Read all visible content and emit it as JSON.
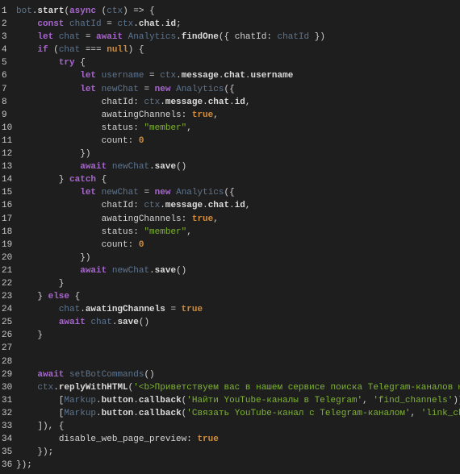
{
  "editor": {
    "colors": {
      "background": "#1e1e1e",
      "keyword": "#a866cf",
      "variable": "#5d7590",
      "property": "#d4d4d4",
      "string": "#7fb432",
      "literal": "#d08c3c"
    },
    "lines": [
      {
        "n": "1",
        "t": [
          [
            "v",
            "bot"
          ],
          [
            "p",
            "."
          ],
          [
            "f",
            "start"
          ],
          [
            "p",
            "("
          ],
          [
            "k",
            "async"
          ],
          [
            "p",
            " ("
          ],
          [
            "v",
            "ctx"
          ],
          [
            "p",
            ") => {"
          ]
        ]
      },
      {
        "n": "2",
        "t": [
          [
            "p",
            "    "
          ],
          [
            "k",
            "const"
          ],
          [
            "p",
            " "
          ],
          [
            "v",
            "chatId"
          ],
          [
            "p",
            " = "
          ],
          [
            "v",
            "ctx"
          ],
          [
            "p",
            "."
          ],
          [
            "f",
            "chat"
          ],
          [
            "p",
            "."
          ],
          [
            "f",
            "id"
          ],
          [
            "p",
            ";"
          ]
        ]
      },
      {
        "n": "3",
        "t": [
          [
            "p",
            "    "
          ],
          [
            "k",
            "let"
          ],
          [
            "p",
            " "
          ],
          [
            "v",
            "chat"
          ],
          [
            "p",
            " = "
          ],
          [
            "k",
            "await"
          ],
          [
            "p",
            " "
          ],
          [
            "v",
            "Analytics"
          ],
          [
            "p",
            "."
          ],
          [
            "f",
            "findOne"
          ],
          [
            "p",
            "({ "
          ],
          [
            "pr",
            "chatId"
          ],
          [
            "p",
            ": "
          ],
          [
            "v",
            "chatId"
          ],
          [
            "p",
            " })"
          ]
        ]
      },
      {
        "n": "4",
        "t": [
          [
            "p",
            "    "
          ],
          [
            "k",
            "if"
          ],
          [
            "p",
            " ("
          ],
          [
            "v",
            "chat"
          ],
          [
            "p",
            " === "
          ],
          [
            "l",
            "null"
          ],
          [
            "p",
            ") {"
          ]
        ]
      },
      {
        "n": "5",
        "t": [
          [
            "p",
            "        "
          ],
          [
            "k",
            "try"
          ],
          [
            "p",
            " {"
          ]
        ]
      },
      {
        "n": "6",
        "t": [
          [
            "p",
            "            "
          ],
          [
            "k",
            "let"
          ],
          [
            "p",
            " "
          ],
          [
            "v",
            "username"
          ],
          [
            "p",
            " = "
          ],
          [
            "v",
            "ctx"
          ],
          [
            "p",
            "."
          ],
          [
            "f",
            "message"
          ],
          [
            "p",
            "."
          ],
          [
            "f",
            "chat"
          ],
          [
            "p",
            "."
          ],
          [
            "f",
            "username"
          ]
        ]
      },
      {
        "n": "7",
        "t": [
          [
            "p",
            "            "
          ],
          [
            "k",
            "let"
          ],
          [
            "p",
            " "
          ],
          [
            "v",
            "newChat"
          ],
          [
            "p",
            " = "
          ],
          [
            "k",
            "new"
          ],
          [
            "p",
            " "
          ],
          [
            "v",
            "Analytics"
          ],
          [
            "p",
            "({"
          ]
        ]
      },
      {
        "n": "8",
        "t": [
          [
            "p",
            "                "
          ],
          [
            "pr",
            "chatId"
          ],
          [
            "p",
            ": "
          ],
          [
            "v",
            "ctx"
          ],
          [
            "p",
            "."
          ],
          [
            "f",
            "message"
          ],
          [
            "p",
            "."
          ],
          [
            "f",
            "chat"
          ],
          [
            "p",
            "."
          ],
          [
            "f",
            "id"
          ],
          [
            "p",
            ","
          ]
        ]
      },
      {
        "n": "9",
        "t": [
          [
            "p",
            "                "
          ],
          [
            "pr",
            "awatingChannels"
          ],
          [
            "p",
            ": "
          ],
          [
            "l",
            "true"
          ],
          [
            "p",
            ","
          ]
        ]
      },
      {
        "n": "10",
        "t": [
          [
            "p",
            "                "
          ],
          [
            "pr",
            "status"
          ],
          [
            "p",
            ": "
          ],
          [
            "s",
            "\"member\""
          ],
          [
            "p",
            ","
          ]
        ]
      },
      {
        "n": "11",
        "t": [
          [
            "p",
            "                "
          ],
          [
            "pr",
            "count"
          ],
          [
            "p",
            ": "
          ],
          [
            "l",
            "0"
          ]
        ]
      },
      {
        "n": "12",
        "t": [
          [
            "p",
            "            })"
          ]
        ]
      },
      {
        "n": "13",
        "t": [
          [
            "p",
            "            "
          ],
          [
            "k",
            "await"
          ],
          [
            "p",
            " "
          ],
          [
            "v",
            "newChat"
          ],
          [
            "p",
            "."
          ],
          [
            "f",
            "save"
          ],
          [
            "p",
            "()"
          ]
        ]
      },
      {
        "n": "14",
        "t": [
          [
            "p",
            "        } "
          ],
          [
            "k",
            "catch"
          ],
          [
            "p",
            " {"
          ]
        ]
      },
      {
        "n": "15",
        "t": [
          [
            "p",
            "            "
          ],
          [
            "k",
            "let"
          ],
          [
            "p",
            " "
          ],
          [
            "v",
            "newChat"
          ],
          [
            "p",
            " = "
          ],
          [
            "k",
            "new"
          ],
          [
            "p",
            " "
          ],
          [
            "v",
            "Analytics"
          ],
          [
            "p",
            "({"
          ]
        ]
      },
      {
        "n": "16",
        "t": [
          [
            "p",
            "                "
          ],
          [
            "pr",
            "chatId"
          ],
          [
            "p",
            ": "
          ],
          [
            "v",
            "ctx"
          ],
          [
            "p",
            "."
          ],
          [
            "f",
            "message"
          ],
          [
            "p",
            "."
          ],
          [
            "f",
            "chat"
          ],
          [
            "p",
            "."
          ],
          [
            "f",
            "id"
          ],
          [
            "p",
            ","
          ]
        ]
      },
      {
        "n": "17",
        "t": [
          [
            "p",
            "                "
          ],
          [
            "pr",
            "awatingChannels"
          ],
          [
            "p",
            ": "
          ],
          [
            "l",
            "true"
          ],
          [
            "p",
            ","
          ]
        ]
      },
      {
        "n": "18",
        "t": [
          [
            "p",
            "                "
          ],
          [
            "pr",
            "status"
          ],
          [
            "p",
            ": "
          ],
          [
            "s",
            "\"member\""
          ],
          [
            "p",
            ","
          ]
        ]
      },
      {
        "n": "19",
        "t": [
          [
            "p",
            "                "
          ],
          [
            "pr",
            "count"
          ],
          [
            "p",
            ": "
          ],
          [
            "l",
            "0"
          ]
        ]
      },
      {
        "n": "20",
        "t": [
          [
            "p",
            "            })"
          ]
        ]
      },
      {
        "n": "21",
        "t": [
          [
            "p",
            "            "
          ],
          [
            "k",
            "await"
          ],
          [
            "p",
            " "
          ],
          [
            "v",
            "newChat"
          ],
          [
            "p",
            "."
          ],
          [
            "f",
            "save"
          ],
          [
            "p",
            "()"
          ]
        ]
      },
      {
        "n": "22",
        "t": [
          [
            "p",
            "        }"
          ]
        ]
      },
      {
        "n": "23",
        "t": [
          [
            "p",
            "    } "
          ],
          [
            "k",
            "else"
          ],
          [
            "p",
            " {"
          ]
        ]
      },
      {
        "n": "24",
        "t": [
          [
            "p",
            "        "
          ],
          [
            "v",
            "chat"
          ],
          [
            "p",
            "."
          ],
          [
            "f",
            "awatingChannels"
          ],
          [
            "p",
            " = "
          ],
          [
            "l",
            "true"
          ]
        ]
      },
      {
        "n": "25",
        "t": [
          [
            "p",
            "        "
          ],
          [
            "k",
            "await"
          ],
          [
            "p",
            " "
          ],
          [
            "v",
            "chat"
          ],
          [
            "p",
            "."
          ],
          [
            "f",
            "save"
          ],
          [
            "p",
            "()"
          ]
        ]
      },
      {
        "n": "26",
        "t": [
          [
            "p",
            "    }"
          ]
        ]
      },
      {
        "n": "27",
        "t": []
      },
      {
        "n": "28",
        "t": []
      },
      {
        "n": "29",
        "t": [
          [
            "p",
            "    "
          ],
          [
            "k",
            "await"
          ],
          [
            "p",
            " "
          ],
          [
            "v",
            "setBotCommands"
          ],
          [
            "p",
            "()"
          ]
        ]
      },
      {
        "n": "30",
        "t": [
          [
            "p",
            "    "
          ],
          [
            "v",
            "ctx"
          ],
          [
            "p",
            "."
          ],
          [
            "f",
            "replyWithHTML"
          ],
          [
            "p",
            "("
          ],
          [
            "s",
            "'<b>Приветствуем вас в нашем сервисе поиска Telegram-каналов ютуб"
          ]
        ]
      },
      {
        "n": "31",
        "t": [
          [
            "p",
            "        ["
          ],
          [
            "v",
            "Markup"
          ],
          [
            "p",
            "."
          ],
          [
            "f",
            "button"
          ],
          [
            "p",
            "."
          ],
          [
            "f",
            "callback"
          ],
          [
            "p",
            "("
          ],
          [
            "s",
            "'Найти YouTube-каналы в Telegram'"
          ],
          [
            "p",
            ", "
          ],
          [
            "s",
            "'find_channels'"
          ],
          [
            "p",
            ")],"
          ]
        ]
      },
      {
        "n": "32",
        "t": [
          [
            "p",
            "        ["
          ],
          [
            "v",
            "Markup"
          ],
          [
            "p",
            "."
          ],
          [
            "f",
            "button"
          ],
          [
            "p",
            "."
          ],
          [
            "f",
            "callback"
          ],
          [
            "p",
            "("
          ],
          [
            "s",
            "'Связать YouTube-канал с Telegram-каналом'"
          ],
          [
            "p",
            ", "
          ],
          [
            "s",
            "'link_chann"
          ]
        ]
      },
      {
        "n": "33",
        "t": [
          [
            "p",
            "    ]), {"
          ]
        ]
      },
      {
        "n": "34",
        "t": [
          [
            "p",
            "        "
          ],
          [
            "pr",
            "disable_web_page_preview"
          ],
          [
            "p",
            ": "
          ],
          [
            "l",
            "true"
          ]
        ]
      },
      {
        "n": "35",
        "t": [
          [
            "p",
            "    });"
          ]
        ]
      },
      {
        "n": "36",
        "t": [
          [
            "p",
            "});"
          ]
        ]
      }
    ]
  }
}
